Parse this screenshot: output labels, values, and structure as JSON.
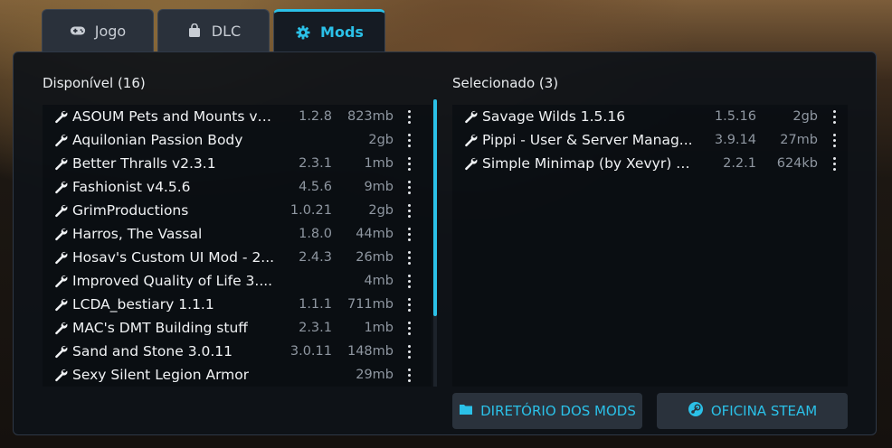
{
  "tabs": [
    {
      "label": "Jogo",
      "icon": "gamepad-icon",
      "active": false
    },
    {
      "label": "DLC",
      "icon": "shopping-bag-icon",
      "active": false
    },
    {
      "label": "Mods",
      "icon": "gear-icon",
      "active": true
    }
  ],
  "available": {
    "title": "Disponível (16)",
    "items": [
      {
        "name": "ASOUM Pets and Mounts v1...",
        "version": "1.2.8",
        "size": "823mb"
      },
      {
        "name": "Aquilonian Passion Body",
        "version": "",
        "size": "2gb"
      },
      {
        "name": "Better Thralls v2.3.1",
        "version": "2.3.1",
        "size": "1mb"
      },
      {
        "name": "Fashionist v4.5.6",
        "version": "4.5.6",
        "size": "9mb"
      },
      {
        "name": "GrimProductions",
        "version": "1.0.21",
        "size": "2gb"
      },
      {
        "name": "Harros, The Vassal",
        "version": "1.8.0",
        "size": "44mb"
      },
      {
        "name": "Hosav's Custom UI Mod - 2...",
        "version": "2.4.3",
        "size": "26mb"
      },
      {
        "name": "Improved Quality of Life 3....",
        "version": "",
        "size": "4mb"
      },
      {
        "name": "LCDA_bestiary 1.1.1",
        "version": "1.1.1",
        "size": "711mb"
      },
      {
        "name": "MAC's DMT Building stuff",
        "version": "2.3.1",
        "size": "1mb"
      },
      {
        "name": "Sand and Stone 3.0.11",
        "version": "3.0.11",
        "size": "148mb"
      },
      {
        "name": "Sexy Silent Legion Armor",
        "version": "",
        "size": "29mb"
      }
    ]
  },
  "selected": {
    "title": "Selecionado (3)",
    "items": [
      {
        "name": "Savage Wilds 1.5.16",
        "version": "1.5.16",
        "size": "2gb"
      },
      {
        "name": "Pippi - User & Server Manag...",
        "version": "3.9.14",
        "size": "27mb"
      },
      {
        "name": "Simple Minimap (by Xevyr) v...",
        "version": "2.2.1",
        "size": "624kb"
      }
    ]
  },
  "buttons": {
    "mods_dir": "DIRETÓRIO DOS MODS",
    "steam_workshop": "OFICINA STEAM"
  },
  "colors": {
    "accent": "#2bc1e8",
    "panel": "#0e1218",
    "tab": "#2a313b"
  }
}
